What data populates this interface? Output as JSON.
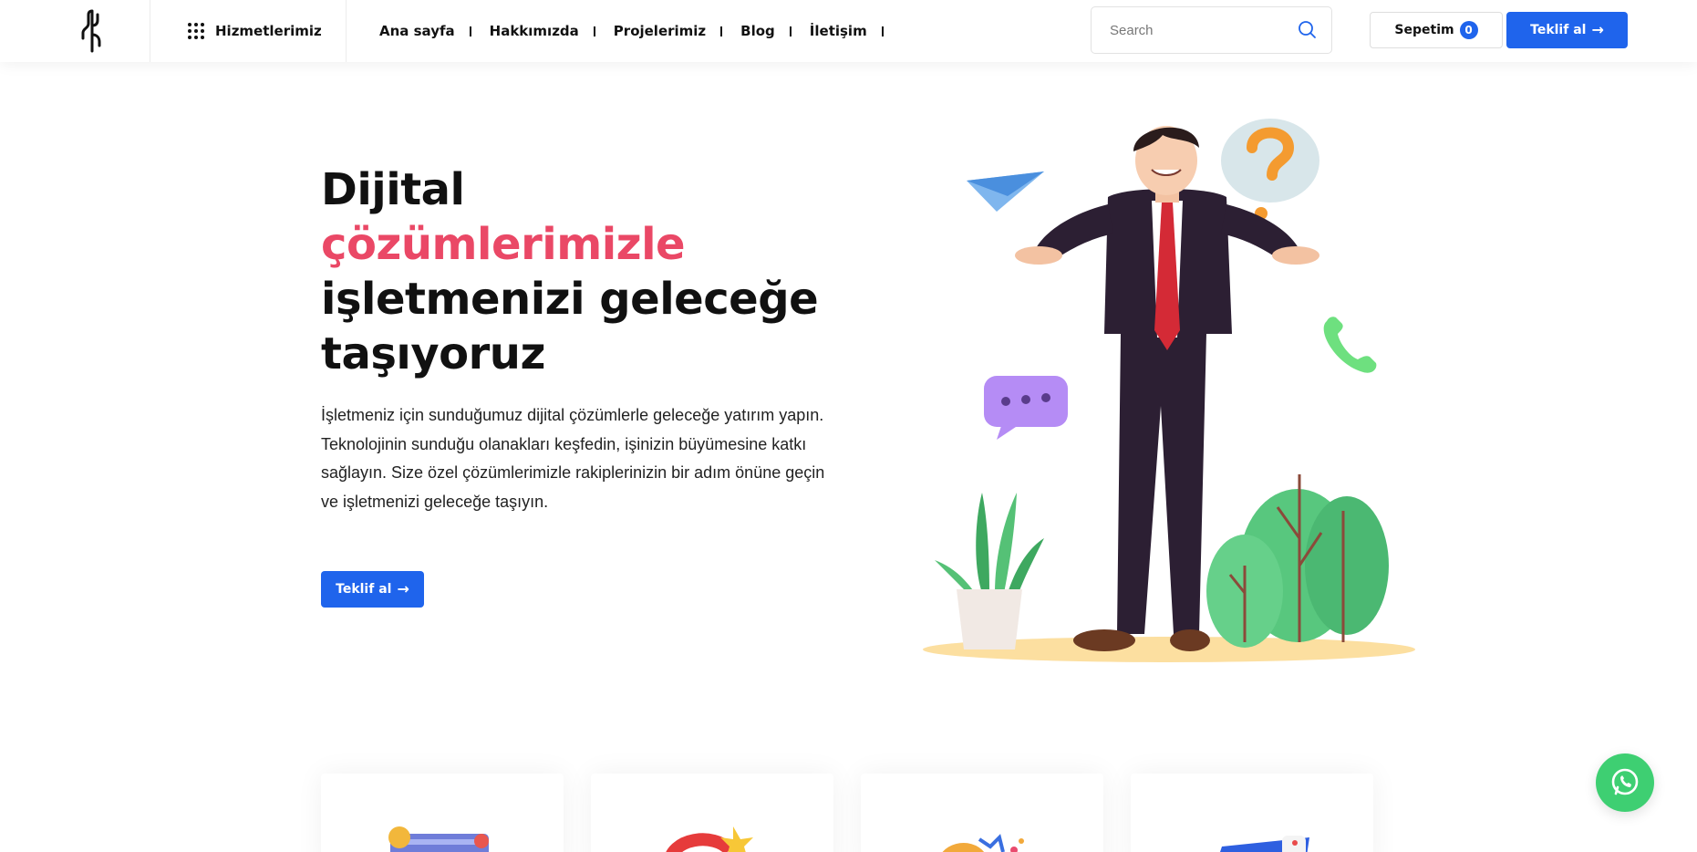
{
  "header": {
    "services_label": "Hizmetlerimiz",
    "nav": [
      {
        "label": "Ana sayfa"
      },
      {
        "label": "Hakkımızda"
      },
      {
        "label": "Projelerimiz"
      },
      {
        "label": "Blog"
      },
      {
        "label": "İletişim"
      }
    ],
    "search_placeholder": "Search",
    "cart_label": "Sepetim",
    "cart_count": "0",
    "quote_label": "Teklif al"
  },
  "hero": {
    "title_line1": "Dijital",
    "title_accent": "çözümlerimizle",
    "title_line3": "işletmenizi geleceğe",
    "title_line4": "taşıyoruz",
    "description": "İşletmeniz için sunduğumuz dijital çözümlerle geleceğe yatırım yapın. Teknolojinin sunduğu olanakları keşfedin, işinizin büyümesine katkı sağlayın. Size özel çözümlerimizle rakiplerinizin bir adım önüne geçin ve işletmenizi geleceğe taşıyın.",
    "cta_label": "Teklif al"
  },
  "colors": {
    "primary": "#1f64ec",
    "accent": "#ea4866",
    "whatsapp": "#3ecf72"
  },
  "icons": {
    "logo": "cactus-logo-icon",
    "services": "grid-dots-icon",
    "search": "search-icon",
    "arrow": "arrow-right-icon",
    "whatsapp": "whatsapp-icon"
  }
}
